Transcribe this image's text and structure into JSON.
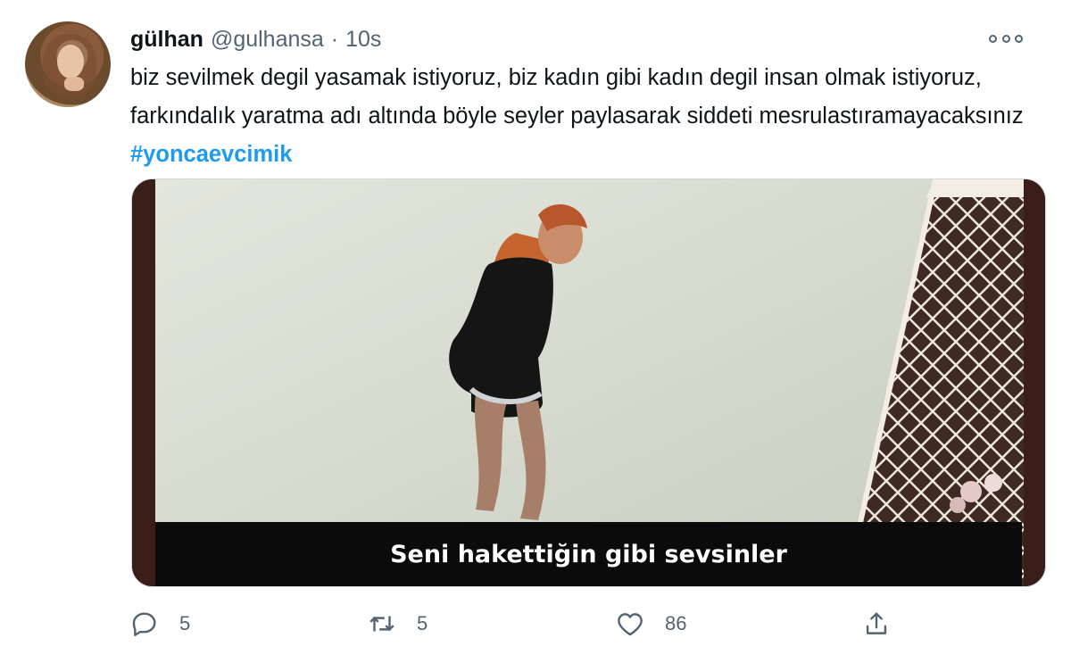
{
  "tweet": {
    "display_name": "gülhan",
    "handle": "@gulhansa",
    "separator": "·",
    "time": "10s",
    "text": "biz sevilmek degil yasamak istiyoruz, biz kadın gibi kadın degil insan olmak istiyoruz, farkındalık yaratma adı altında böyle seyler paylasarak siddeti mesrulastıramayacaksınız ",
    "hashtag": "#yoncaevcimik",
    "media": {
      "caption": "Seni hakettiğin gibi sevsinler"
    },
    "actions": {
      "reply_count": "5",
      "retweet_count": "5",
      "like_count": "86"
    }
  },
  "icons": {
    "more": "more-icon",
    "reply": "reply-icon",
    "retweet": "retweet-icon",
    "like": "heart-icon",
    "share": "share-icon"
  },
  "colors": {
    "hashtag": "#1d9bf0",
    "secondary_text": "#536471"
  }
}
